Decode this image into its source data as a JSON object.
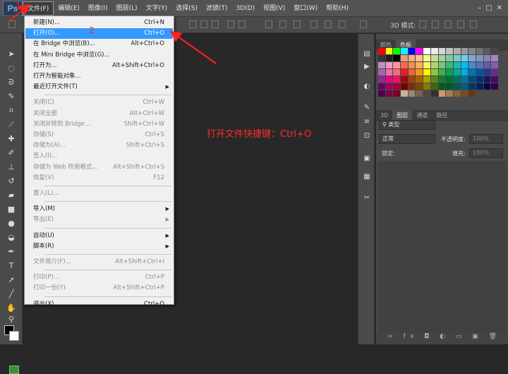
{
  "app": {
    "logo": "Ps"
  },
  "menubar": {
    "items": [
      "文件(F)",
      "编辑(E)",
      "图像(I)",
      "图层(L)",
      "文字(Y)",
      "选择(S)",
      "滤镜(T)",
      "3D(D)",
      "视图(V)",
      "窗口(W)",
      "帮助(H)"
    ],
    "window_buttons": [
      "–",
      "□",
      "✕"
    ]
  },
  "options_bar": {
    "mode_label": "3D 模式:"
  },
  "file_menu": {
    "groups": [
      [
        {
          "label": "新建(N)...",
          "shortcut": "Ctrl+N",
          "enabled": true
        },
        {
          "label": "打开(O)...",
          "shortcut": "Ctrl+O",
          "enabled": true,
          "highlighted": true
        },
        {
          "label": "在 Bridge 中浏览(B)...",
          "shortcut": "Alt+Ctrl+O",
          "enabled": true
        },
        {
          "label": "在 Mini Bridge 中浏览(G)...",
          "shortcut": "",
          "enabled": true
        },
        {
          "label": "打开为...",
          "shortcut": "Alt+Shift+Ctrl+O",
          "enabled": true
        },
        {
          "label": "打开为智能对象...",
          "shortcut": "",
          "enabled": true
        },
        {
          "label": "最近打开文件(T)",
          "shortcut": "",
          "enabled": true,
          "submenu": true
        }
      ],
      [
        {
          "label": "关闭(C)",
          "shortcut": "Ctrl+W",
          "enabled": false
        },
        {
          "label": "关闭全部",
          "shortcut": "Alt+Ctrl+W",
          "enabled": false
        },
        {
          "label": "关闭并转到 Bridge...",
          "shortcut": "Shift+Ctrl+W",
          "enabled": false
        },
        {
          "label": "存储(S)",
          "shortcut": "Ctrl+S",
          "enabled": false
        },
        {
          "label": "存储为(A)...",
          "shortcut": "Shift+Ctrl+S",
          "enabled": false
        },
        {
          "label": "签入(I)...",
          "shortcut": "",
          "enabled": false
        },
        {
          "label": "存储为 Web 所用格式...",
          "shortcut": "Alt+Shift+Ctrl+S",
          "enabled": false
        },
        {
          "label": "恢复(V)",
          "shortcut": "F12",
          "enabled": false
        }
      ],
      [
        {
          "label": "置入(L)...",
          "shortcut": "",
          "enabled": false
        }
      ],
      [
        {
          "label": "导入(M)",
          "shortcut": "",
          "enabled": true,
          "submenu": true
        },
        {
          "label": "导出(E)",
          "shortcut": "",
          "enabled": false,
          "submenu": true
        }
      ],
      [
        {
          "label": "自动(U)",
          "shortcut": "",
          "enabled": true,
          "submenu": true
        },
        {
          "label": "脚本(R)",
          "shortcut": "",
          "enabled": true,
          "submenu": true
        }
      ],
      [
        {
          "label": "文件简介(F)...",
          "shortcut": "Alt+Shift+Ctrl+I",
          "enabled": false
        }
      ],
      [
        {
          "label": "打印(P)...",
          "shortcut": "Ctrl+P",
          "enabled": false
        },
        {
          "label": "打印一份(Y)",
          "shortcut": "Alt+Shift+Ctrl+P",
          "enabled": false
        }
      ],
      [
        {
          "label": "退出(X)",
          "shortcut": "Ctrl+Q",
          "enabled": true
        }
      ]
    ]
  },
  "annotations": {
    "step1": "1",
    "step2": "2",
    "hint": "打开文件快捷键：Ctrl+O",
    "color": "#ff2020"
  },
  "panels": {
    "color_tabs": [
      "颜色",
      "色板"
    ],
    "layer_tabs": [
      "3D",
      "图层",
      "通道",
      "路径"
    ],
    "filter_label": "类型",
    "blend_mode": "正常",
    "opacity_label": "不透明度:",
    "opacity_value": "100%",
    "lock_label": "锁定:",
    "fill_label": "填充:",
    "fill_value": "100%",
    "footer_icons": "∞ fx ◘ ◐ ▭ ▣ 🗑"
  },
  "swatch_colors": [
    "#ff0000",
    "#ffff00",
    "#00ff00",
    "#00ffff",
    "#0000ff",
    "#ff00ff",
    "#ffffff",
    "#ebebeb",
    "#d6d6d6",
    "#c2c2c2",
    "#adadad",
    "#999999",
    "#858585",
    "#707070",
    "#5c5c5c",
    "#474747",
    "#333333",
    "#1f1f1f",
    "#000000",
    "#f7977a",
    "#f9ad81",
    "#fdc68a",
    "#fff79a",
    "#c4df9b",
    "#a2d39c",
    "#82ca9d",
    "#7bcdc8",
    "#6ecff6",
    "#7ea7d8",
    "#8493ca",
    "#8882be",
    "#a187be",
    "#bc8dbf",
    "#f49ac2",
    "#f6989d",
    "#f26c4f",
    "#f68e55",
    "#fbaf5c",
    "#fff467",
    "#acd372",
    "#7cc576",
    "#3bb878",
    "#1abbb4",
    "#00bff3",
    "#438ccb",
    "#5574b9",
    "#605ca8",
    "#855fa8",
    "#a763a8",
    "#f06ea9",
    "#f26d7d",
    "#ed1c24",
    "#f26522",
    "#f7941d",
    "#fff200",
    "#8dc73f",
    "#39b54a",
    "#00a651",
    "#00a99d",
    "#00aeef",
    "#0072bc",
    "#0054a6",
    "#2e3192",
    "#662d91",
    "#92278f",
    "#ec008c",
    "#ed145b",
    "#9e0b0f",
    "#a0410d",
    "#a36209",
    "#aba000",
    "#598527",
    "#197b30",
    "#007236",
    "#00746b",
    "#0076a3",
    "#004b80",
    "#003471",
    "#1b1464",
    "#440e62",
    "#630460",
    "#9e005d",
    "#9e0039",
    "#790000",
    "#7b2e00",
    "#7d4900",
    "#827b00",
    "#406618",
    "#005e20",
    "#005826",
    "#005952",
    "#005b7f",
    "#003663",
    "#002157",
    "#0d004c",
    "#32004b",
    "#4b0049",
    "#7b0046",
    "#7a0026",
    "#c7b299",
    "#998675",
    "#736357",
    "#534741",
    "#37302a",
    "#c69c6d",
    "#a67c52",
    "#8c6239",
    "#754c24",
    "#603913"
  ]
}
